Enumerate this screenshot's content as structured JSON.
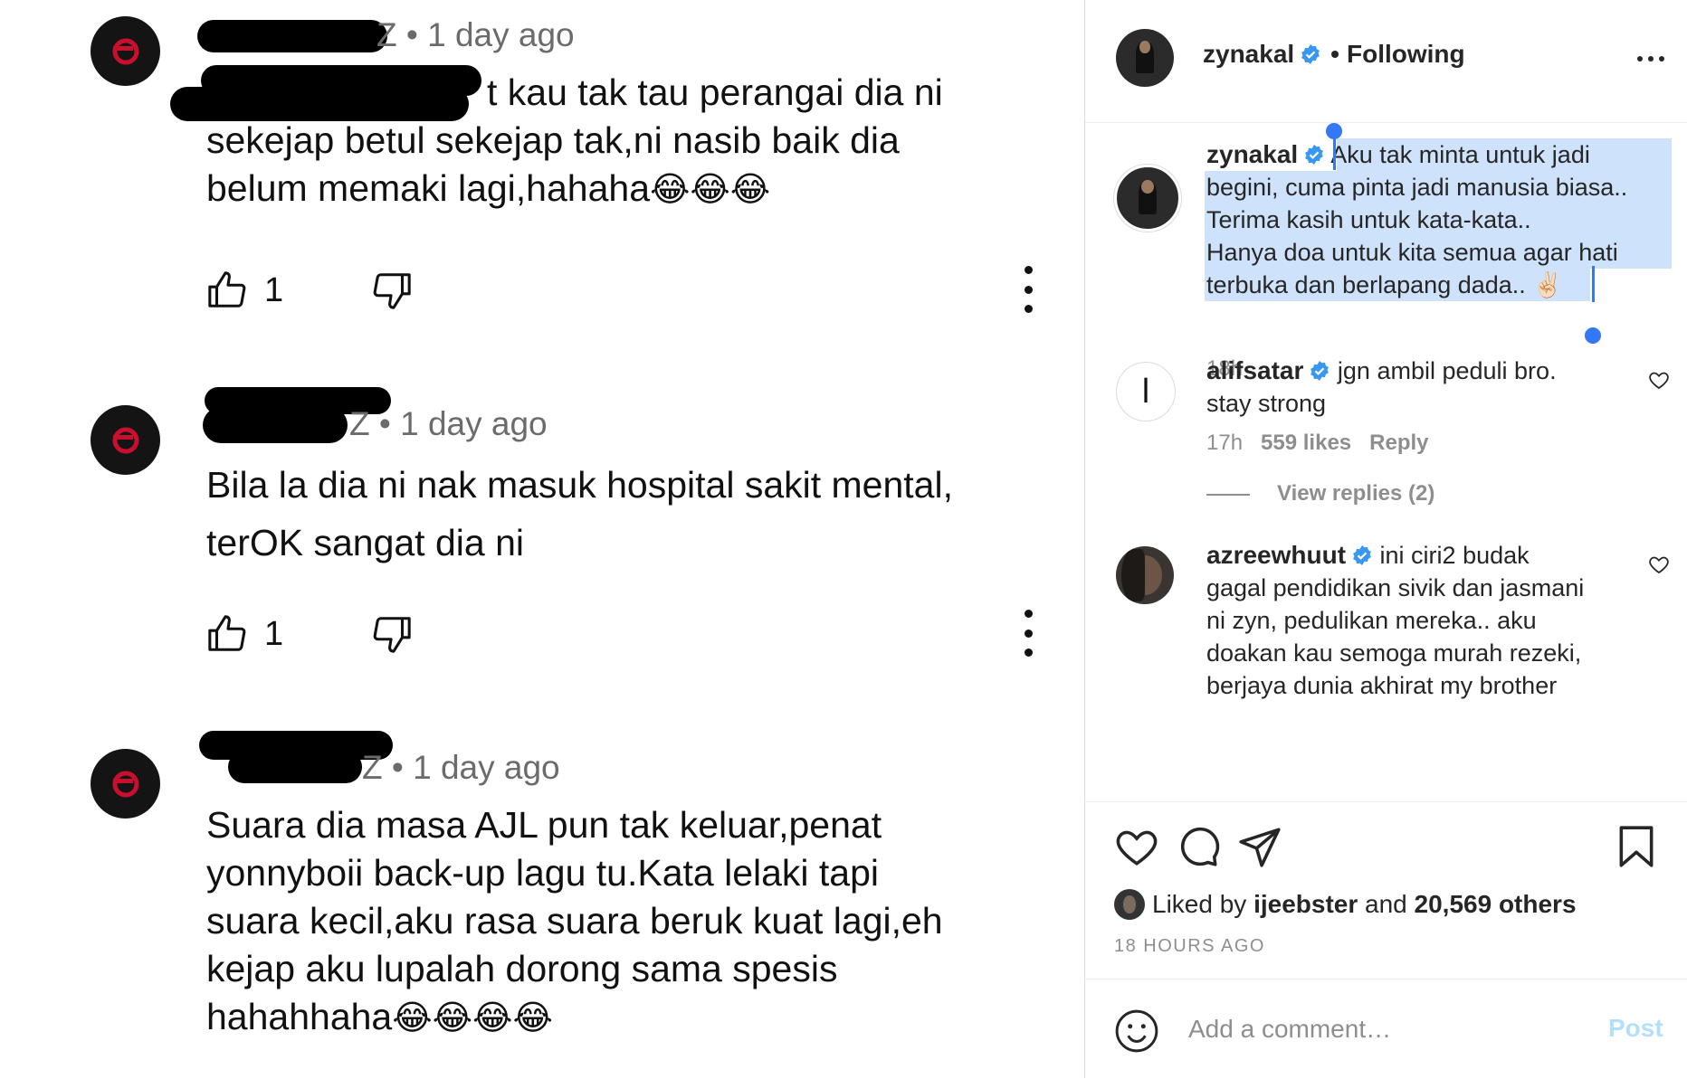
{
  "youtube": {
    "comments": [
      {
        "meta": "Z • 1 day ago",
        "lines": [
          "t kau tak tau perangai dia ni",
          "sekejap betul sekejap tak,ni nasib baik dia",
          "belum memaki lagi,hahaha"
        ],
        "emoji": "😂😂😂",
        "likes": "1"
      },
      {
        "meta": "Z • 1 day ago",
        "lines": [
          "Bila la dia ni nak masuk hospital sakit mental,",
          "terOK sangat dia ni"
        ],
        "emoji": "",
        "likes": "1"
      },
      {
        "meta": "Z • 1 day ago",
        "lines": [
          "Suara dia masa AJL pun tak keluar,penat",
          "yonnyboii back-up lagu tu.Kata lelaki tapi",
          "suara kecil,aku rasa suara beruk kuat lagi,eh",
          "kejap aku lupalah dorong sama spesis",
          "hahahhaha"
        ],
        "emoji": "😂😂😂😂",
        "likes": ""
      }
    ],
    "icons": {
      "like": "thumbs-up-icon",
      "dislike": "thumbs-down-icon",
      "more": "more-vertical-icon"
    }
  },
  "instagram": {
    "header": {
      "username": "zynakal",
      "separator": "•",
      "follow_status": "Following"
    },
    "caption": {
      "username": "zynakal",
      "lines": [
        "Aku tak minta untuk jadi",
        "begini, cuma pinta jadi manusia biasa..",
        "Terima kasih untuk kata-kata..",
        "Hanya doa untuk kita semua agar hati",
        "terbuka dan berlapang dada.. ✌🏻"
      ],
      "time": "18h"
    },
    "comments": [
      {
        "username": "alifsatar",
        "text_first": "jgn ambil peduli bro.",
        "text_rest": [
          "stay strong"
        ],
        "time": "17h",
        "likes": "559 likes",
        "reply": "Reply",
        "view_replies": "View replies (2)"
      },
      {
        "username": "azreewhuut",
        "text_first": "ini ciri2 budak",
        "text_rest": [
          "gagal pendidikan sivik dan jasmani",
          "ni zyn, pedulikan mereka.. aku",
          "doakan kau semoga murah rezeki,",
          "berjaya dunia akhirat my brother"
        ]
      }
    ],
    "likes": {
      "prefix": "Liked by",
      "user": "ijeebster",
      "middle": "and",
      "count": "20,569 others"
    },
    "post_time": "18 HOURS AGO",
    "add_comment": {
      "placeholder": "Add a comment…",
      "post_label": "Post"
    },
    "colors": {
      "verified": "#3897f0",
      "selection": "#cfe2fb",
      "selection_handle": "#3478f6",
      "post_disabled": "#b2dffc"
    }
  }
}
